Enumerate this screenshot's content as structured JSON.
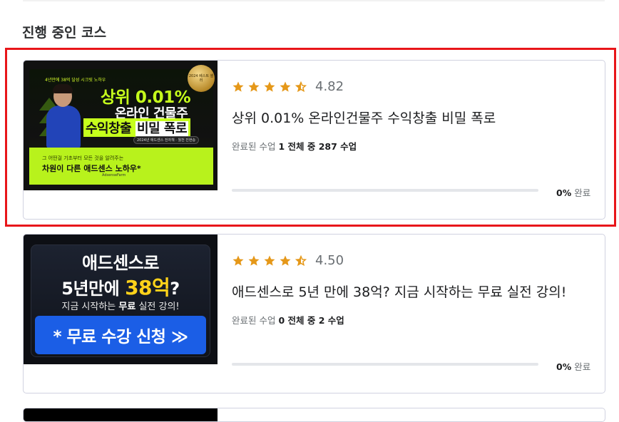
{
  "section": {
    "title": "진행 중인 코스"
  },
  "courses": [
    {
      "rating": 4.82,
      "rating_text": "4.82",
      "title": "상위 0.01% 온라인건물주 수익창출 비밀 폭로",
      "lessons_prefix": "완료된 수업",
      "lessons_detail": "1 전체 중 287 수업",
      "progress_value": "0%",
      "progress_suffix": "완료",
      "progress_fraction": 0,
      "thumbnail": {
        "topline": "4년만에 38억 달성 시크릿 노하우",
        "headline1": "상위 0.01%",
        "headline2": "온라인 건물주",
        "headline3a": "수익창출",
        "headline3b": "비밀 폭로",
        "pill": "2024년 애드센스 전자책 · 월천 진현승",
        "sub1": "그 어떤걸 기초부터 모든 것을 알려주는",
        "sub2": "차원이 다른 애드센스 노하우*",
        "brand": "AdsenseFarm",
        "badge": "2024 베스트 셀러"
      }
    },
    {
      "rating": 4.5,
      "rating_text": "4.50",
      "title": "애드센스로 5년 만에 38억? 지금 시작하는 무료 실전 강의!",
      "lessons_prefix": "완료된 수업",
      "lessons_detail": "0 전체 중 2 수업",
      "progress_value": "0%",
      "progress_suffix": "완료",
      "progress_fraction": 0,
      "thumbnail": {
        "line1": "애드센스로",
        "line2a": "5년만에 ",
        "line2b": "38억",
        "line2c": "?",
        "line3a": "지금 시작하는 ",
        "line3b": "무료",
        "line3c": " 실전 강의!",
        "cta": "* 무료 수강 신청 ≫"
      }
    }
  ],
  "colors": {
    "star": "#e59819",
    "highlight_border": "#e8161a",
    "progress_track": "#e4e6ea"
  },
  "icons": {
    "star": "star-icon",
    "half_star": "half-star-icon"
  }
}
